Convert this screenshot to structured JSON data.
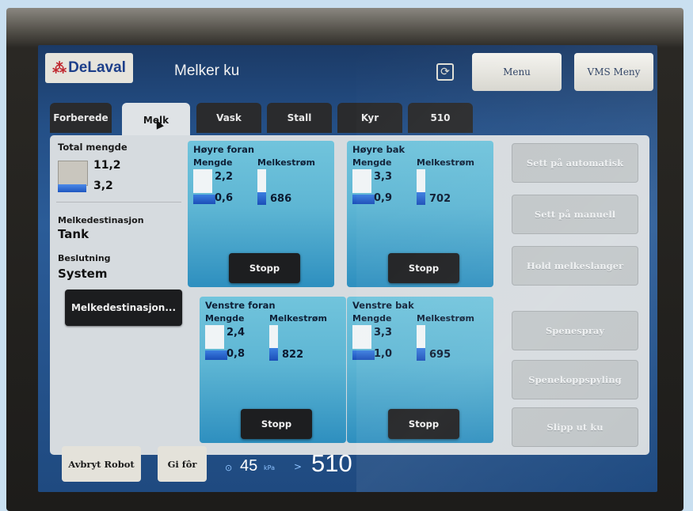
{
  "header": {
    "logo_text": "DeLaval",
    "logo_mark": "⁂",
    "title": "Melker ku",
    "sync_icon": "sync-icon",
    "menu_btn": "Menu",
    "vms_btn": "VMS Meny"
  },
  "tabs": [
    {
      "label": "Forberede"
    },
    {
      "label": "Melk"
    },
    {
      "label": "Vask"
    },
    {
      "label": "Stall"
    },
    {
      "label": "Kyr"
    },
    {
      "label": "510"
    }
  ],
  "left": {
    "total_label": "Total mengde",
    "total_value": "11,2",
    "current_value": "3,2",
    "destination_label": "Melkedestinasjon",
    "destination_value": "Tank",
    "decision_label": "Beslutning",
    "decision_value": "System",
    "destination_btn": "Melkedestinasjon..."
  },
  "quarters": [
    {
      "name": "Høyre foran",
      "amount_label": "Mengde",
      "flow_label": "Melkestrøm",
      "expected": "2,2",
      "actual": "0,6",
      "flow": "686",
      "stop": "Stopp"
    },
    {
      "name": "Høyre bak",
      "amount_label": "Mengde",
      "flow_label": "Melkestrøm",
      "expected": "3,3",
      "actual": "0,9",
      "flow": "702",
      "stop": "Stopp"
    },
    {
      "name": "Venstre foran",
      "amount_label": "Mengde",
      "flow_label": "Melkestrøm",
      "expected": "2,4",
      "actual": "0,8",
      "flow": "822",
      "stop": "Stopp"
    },
    {
      "name": "Venstre bak",
      "amount_label": "Mengde",
      "flow_label": "Melkestrøm",
      "expected": "3,3",
      "actual": "1,0",
      "flow": "695",
      "stop": "Stopp"
    }
  ],
  "right_buttons": [
    {
      "label": "Sett på automatisk"
    },
    {
      "label": "Sett på manuell"
    },
    {
      "label": "Hold melkeslanger"
    },
    {
      "label": "Spenespray"
    },
    {
      "label": "Spenekoppspyling"
    },
    {
      "label": "Slipp ut ku"
    }
  ],
  "bottom": {
    "abort_btn": "Avbryt Robot",
    "feed_btn": "Gi fôr",
    "pressure_value": "45",
    "pressure_unit": "kPa",
    "cow_number": "510"
  },
  "colors": {
    "screen": "#244f86",
    "panel": "#d6dbdf",
    "card": "#5eb6d4",
    "bar": "#1e56c0"
  }
}
